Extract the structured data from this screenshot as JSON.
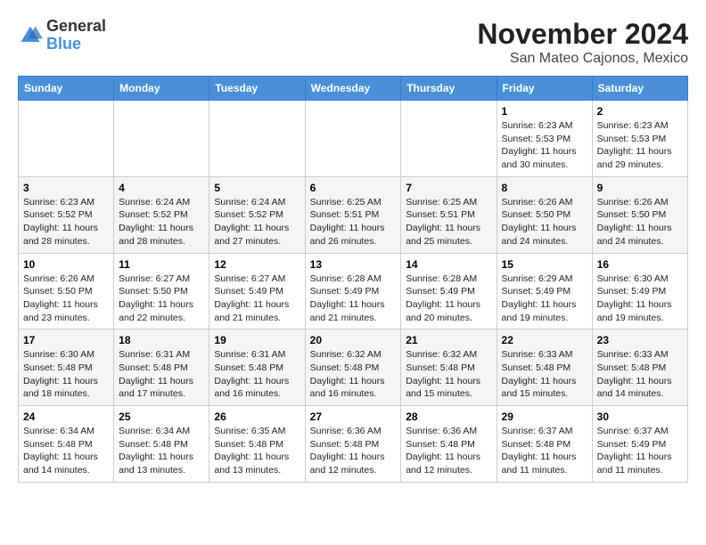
{
  "logo": {
    "general": "General",
    "blue": "Blue"
  },
  "title": "November 2024",
  "location": "San Mateo Cajonos, Mexico",
  "days_of_week": [
    "Sunday",
    "Monday",
    "Tuesday",
    "Wednesday",
    "Thursday",
    "Friday",
    "Saturday"
  ],
  "weeks": [
    [
      {
        "day": "",
        "info": ""
      },
      {
        "day": "",
        "info": ""
      },
      {
        "day": "",
        "info": ""
      },
      {
        "day": "",
        "info": ""
      },
      {
        "day": "",
        "info": ""
      },
      {
        "day": "1",
        "info": "Sunrise: 6:23 AM\nSunset: 5:53 PM\nDaylight: 11 hours and 30 minutes."
      },
      {
        "day": "2",
        "info": "Sunrise: 6:23 AM\nSunset: 5:53 PM\nDaylight: 11 hours and 29 minutes."
      }
    ],
    [
      {
        "day": "3",
        "info": "Sunrise: 6:23 AM\nSunset: 5:52 PM\nDaylight: 11 hours and 28 minutes."
      },
      {
        "day": "4",
        "info": "Sunrise: 6:24 AM\nSunset: 5:52 PM\nDaylight: 11 hours and 28 minutes."
      },
      {
        "day": "5",
        "info": "Sunrise: 6:24 AM\nSunset: 5:52 PM\nDaylight: 11 hours and 27 minutes."
      },
      {
        "day": "6",
        "info": "Sunrise: 6:25 AM\nSunset: 5:51 PM\nDaylight: 11 hours and 26 minutes."
      },
      {
        "day": "7",
        "info": "Sunrise: 6:25 AM\nSunset: 5:51 PM\nDaylight: 11 hours and 25 minutes."
      },
      {
        "day": "8",
        "info": "Sunrise: 6:26 AM\nSunset: 5:50 PM\nDaylight: 11 hours and 24 minutes."
      },
      {
        "day": "9",
        "info": "Sunrise: 6:26 AM\nSunset: 5:50 PM\nDaylight: 11 hours and 24 minutes."
      }
    ],
    [
      {
        "day": "10",
        "info": "Sunrise: 6:26 AM\nSunset: 5:50 PM\nDaylight: 11 hours and 23 minutes."
      },
      {
        "day": "11",
        "info": "Sunrise: 6:27 AM\nSunset: 5:50 PM\nDaylight: 11 hours and 22 minutes."
      },
      {
        "day": "12",
        "info": "Sunrise: 6:27 AM\nSunset: 5:49 PM\nDaylight: 11 hours and 21 minutes."
      },
      {
        "day": "13",
        "info": "Sunrise: 6:28 AM\nSunset: 5:49 PM\nDaylight: 11 hours and 21 minutes."
      },
      {
        "day": "14",
        "info": "Sunrise: 6:28 AM\nSunset: 5:49 PM\nDaylight: 11 hours and 20 minutes."
      },
      {
        "day": "15",
        "info": "Sunrise: 6:29 AM\nSunset: 5:49 PM\nDaylight: 11 hours and 19 minutes."
      },
      {
        "day": "16",
        "info": "Sunrise: 6:30 AM\nSunset: 5:49 PM\nDaylight: 11 hours and 19 minutes."
      }
    ],
    [
      {
        "day": "17",
        "info": "Sunrise: 6:30 AM\nSunset: 5:48 PM\nDaylight: 11 hours and 18 minutes."
      },
      {
        "day": "18",
        "info": "Sunrise: 6:31 AM\nSunset: 5:48 PM\nDaylight: 11 hours and 17 minutes."
      },
      {
        "day": "19",
        "info": "Sunrise: 6:31 AM\nSunset: 5:48 PM\nDaylight: 11 hours and 16 minutes."
      },
      {
        "day": "20",
        "info": "Sunrise: 6:32 AM\nSunset: 5:48 PM\nDaylight: 11 hours and 16 minutes."
      },
      {
        "day": "21",
        "info": "Sunrise: 6:32 AM\nSunset: 5:48 PM\nDaylight: 11 hours and 15 minutes."
      },
      {
        "day": "22",
        "info": "Sunrise: 6:33 AM\nSunset: 5:48 PM\nDaylight: 11 hours and 15 minutes."
      },
      {
        "day": "23",
        "info": "Sunrise: 6:33 AM\nSunset: 5:48 PM\nDaylight: 11 hours and 14 minutes."
      }
    ],
    [
      {
        "day": "24",
        "info": "Sunrise: 6:34 AM\nSunset: 5:48 PM\nDaylight: 11 hours and 14 minutes."
      },
      {
        "day": "25",
        "info": "Sunrise: 6:34 AM\nSunset: 5:48 PM\nDaylight: 11 hours and 13 minutes."
      },
      {
        "day": "26",
        "info": "Sunrise: 6:35 AM\nSunset: 5:48 PM\nDaylight: 11 hours and 13 minutes."
      },
      {
        "day": "27",
        "info": "Sunrise: 6:36 AM\nSunset: 5:48 PM\nDaylight: 11 hours and 12 minutes."
      },
      {
        "day": "28",
        "info": "Sunrise: 6:36 AM\nSunset: 5:48 PM\nDaylight: 11 hours and 12 minutes."
      },
      {
        "day": "29",
        "info": "Sunrise: 6:37 AM\nSunset: 5:48 PM\nDaylight: 11 hours and 11 minutes."
      },
      {
        "day": "30",
        "info": "Sunrise: 6:37 AM\nSunset: 5:49 PM\nDaylight: 11 hours and 11 minutes."
      }
    ]
  ]
}
